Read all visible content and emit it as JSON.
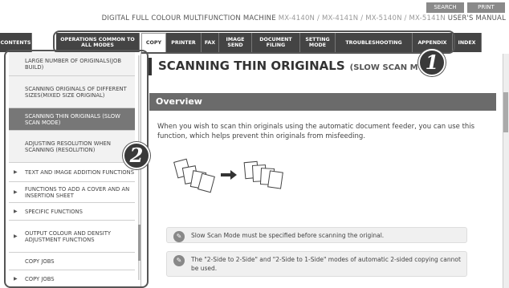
{
  "utility": {
    "search": "SEARCH",
    "print": "PRINT"
  },
  "header": {
    "title_pre": "DIGITAL FULL COLOUR MULTIFUNCTION MACHINE ",
    "models": "MX-4140N / MX-4141N / MX-5140N / MX-5141N",
    "title_post": " USER'S MANUAL"
  },
  "nav": {
    "tabs": [
      {
        "label": "CONTENTS"
      },
      {
        "label": "OPERATIONS COMMON TO ALL MODES"
      },
      {
        "label": "COPY"
      },
      {
        "label": "PRINTER"
      },
      {
        "label": "FAX"
      },
      {
        "label": "IMAGE SEND"
      },
      {
        "label": "DOCUMENT FILING"
      },
      {
        "label": "SETTING MODE"
      },
      {
        "label": "TROUBLESHOOTING"
      },
      {
        "label": "APPENDIX"
      },
      {
        "label": "INDEX"
      }
    ]
  },
  "sidebar": {
    "items": [
      {
        "label": "LARGE NUMBER OF ORIGINALS(JOB BUILD)"
      },
      {
        "label": "SCANNING ORIGINALS OF DIFFERENT SIZES(MIXED SIZE ORIGINAL)"
      },
      {
        "label": "SCANNING THIN ORIGINALS (SLOW SCAN MODE)"
      },
      {
        "label": "ADJUSTING RESOLUTION WHEN SCANNING (RESOLUTION)"
      },
      {
        "label": "TEXT AND IMAGE ADDITION FUNCTIONS"
      },
      {
        "label": "FUNCTIONS TO ADD A COVER AND AN INSERTION SHEET"
      },
      {
        "label": "SPECIFIC FUNCTIONS"
      },
      {
        "label": "OUTPUT COLOUR AND DENSITY ADJUSTMENT FUNCTIONS"
      },
      {
        "label": "COPY JOBS"
      },
      {
        "label": "COPY JOBS"
      }
    ]
  },
  "badges": {
    "one": "1",
    "two": "2"
  },
  "main": {
    "title": "SCANNING THIN ORIGINALS",
    "subtitle": "(SLOW SCAN M",
    "overview": "Overview",
    "paragraph": "When you wish to scan thin originals using the automatic document feeder, you can use this function, which helps prevent thin originals from misfeeding.",
    "notes": [
      "Slow Scan Mode must be specified before scanning the original.",
      "The \"2-Side to 2-Side\" and \"2-Side to 1-Side\" modes of automatic 2-sided copying cannot be used."
    ]
  }
}
